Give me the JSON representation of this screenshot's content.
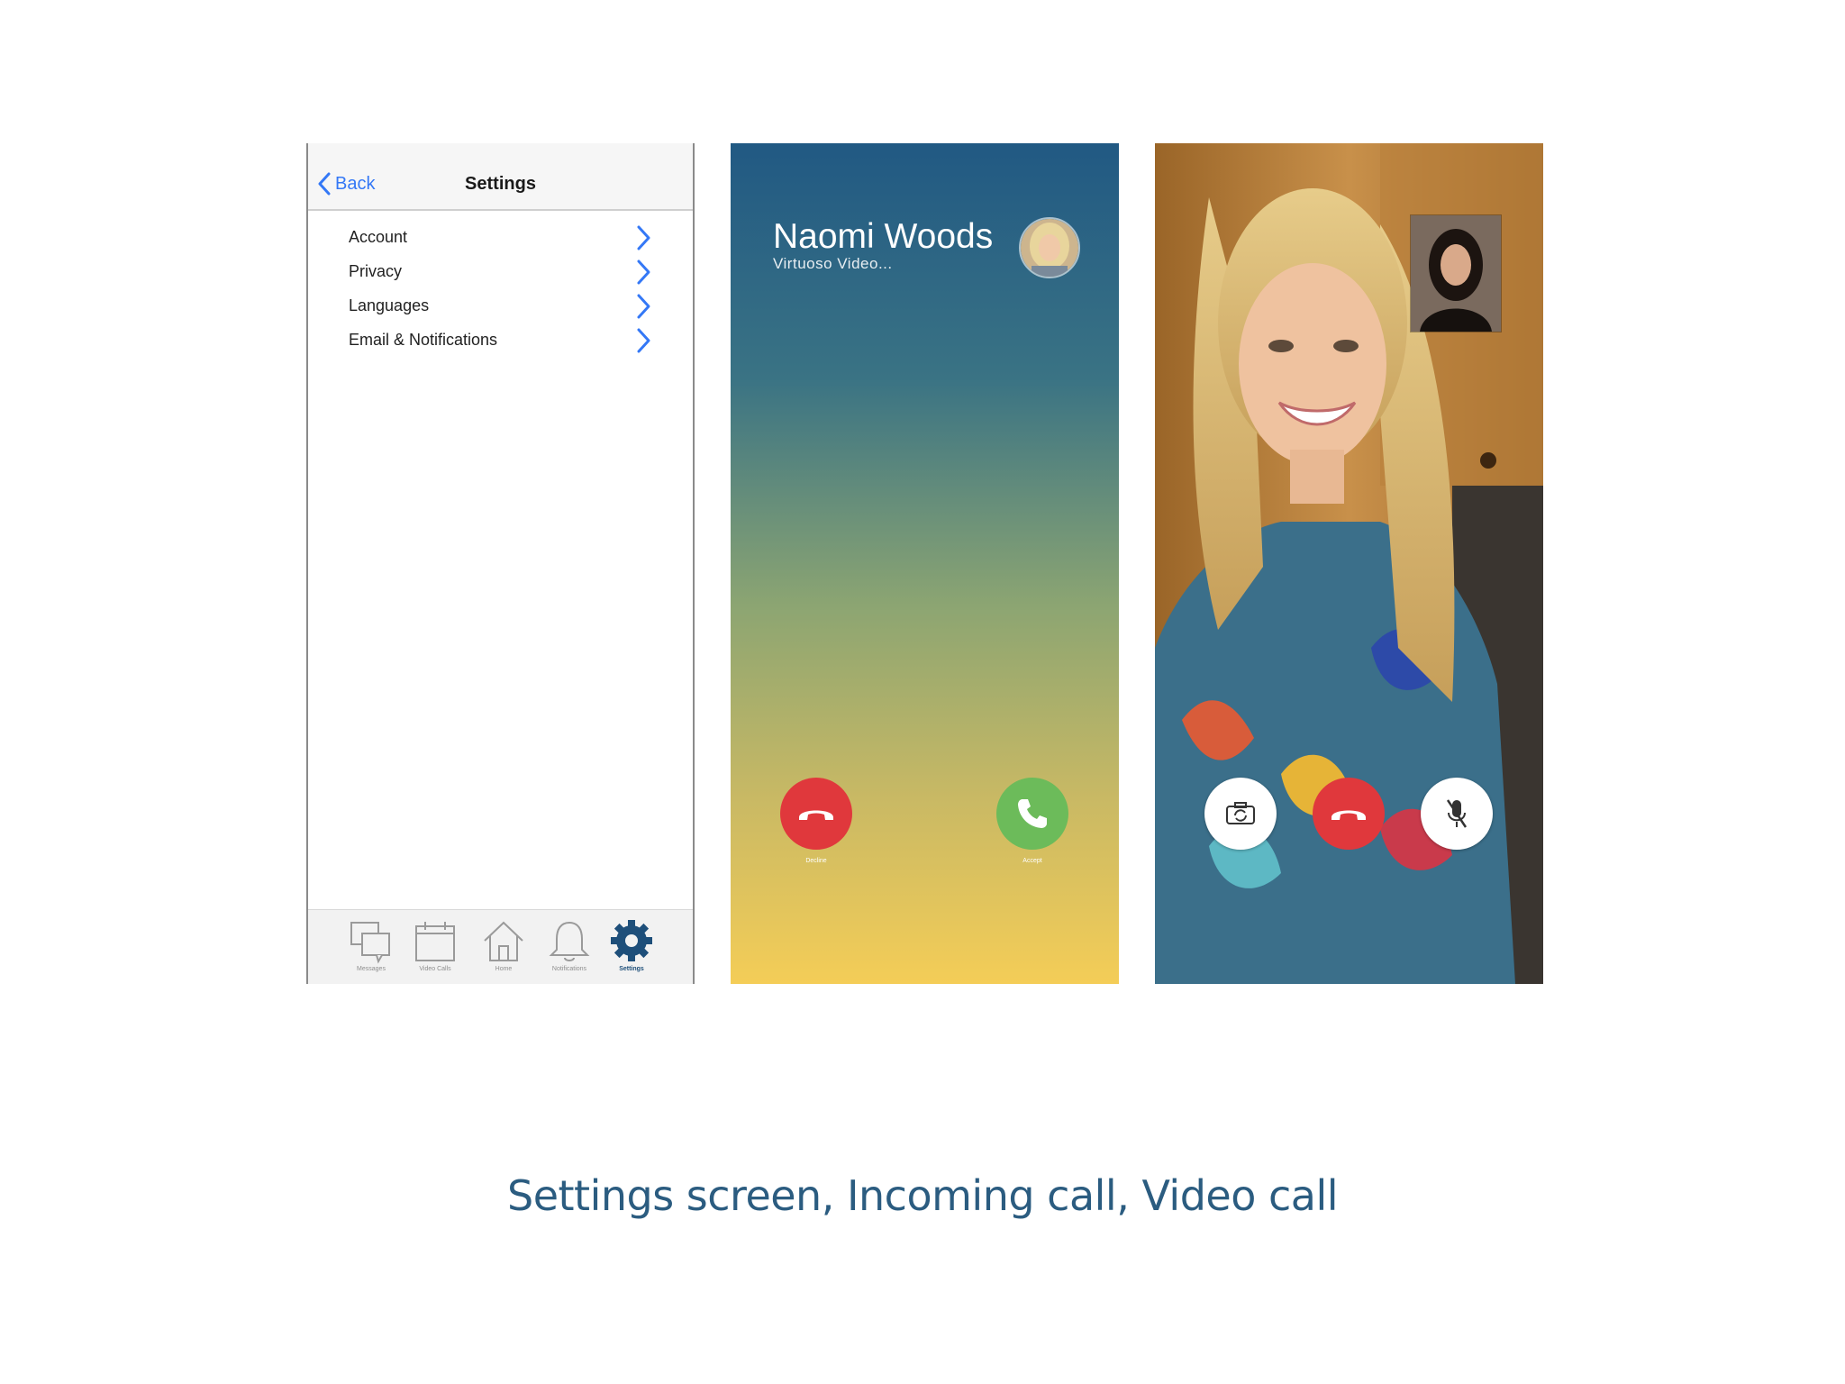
{
  "settings_screen": {
    "nav": {
      "back_label": "Back",
      "title": "Settings"
    },
    "menu_items": [
      {
        "label": "Account"
      },
      {
        "label": "Privacy"
      },
      {
        "label": "Languages"
      },
      {
        "label": "Email & Notifications"
      }
    ],
    "tabs": [
      {
        "label": "Messages",
        "icon": "messages-icon",
        "active": false
      },
      {
        "label": "Video Calls",
        "icon": "calendar-icon",
        "active": false
      },
      {
        "label": "Home",
        "icon": "home-icon",
        "active": false
      },
      {
        "label": "Notifications",
        "icon": "bell-icon",
        "active": false
      },
      {
        "label": "Settings",
        "icon": "gear-icon",
        "active": true
      }
    ],
    "accent_color": "#3478f6",
    "active_tab_color": "#1e4f7a"
  },
  "incoming_call": {
    "caller_name": "Naomi Woods",
    "caller_status": "Virtuoso Video...",
    "decline_label": "Decline",
    "accept_label": "Accept",
    "decline_color": "#e0383c",
    "accept_color": "#6cbb5a"
  },
  "video_call": {
    "controls": [
      "camera-switch-icon",
      "hang-up-icon",
      "mute-mic-icon"
    ]
  },
  "caption": "Settings screen, Incoming call, Video call"
}
